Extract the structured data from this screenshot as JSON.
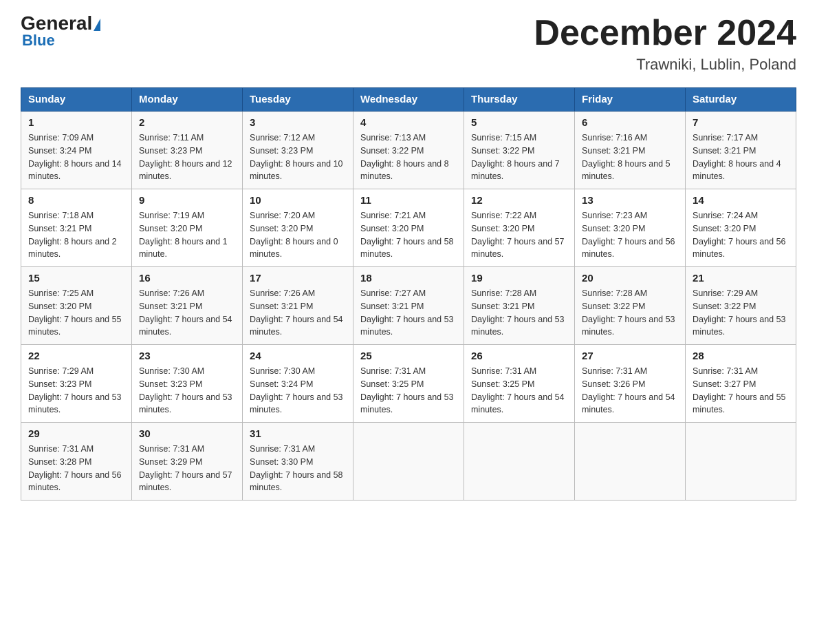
{
  "header": {
    "logo_general": "General",
    "logo_blue": "Blue",
    "month_title": "December 2024",
    "location": "Trawniki, Lublin, Poland"
  },
  "weekdays": [
    "Sunday",
    "Monday",
    "Tuesday",
    "Wednesday",
    "Thursday",
    "Friday",
    "Saturday"
  ],
  "weeks": [
    [
      {
        "day": "1",
        "sunrise": "7:09 AM",
        "sunset": "3:24 PM",
        "daylight": "8 hours and 14 minutes."
      },
      {
        "day": "2",
        "sunrise": "7:11 AM",
        "sunset": "3:23 PM",
        "daylight": "8 hours and 12 minutes."
      },
      {
        "day": "3",
        "sunrise": "7:12 AM",
        "sunset": "3:23 PM",
        "daylight": "8 hours and 10 minutes."
      },
      {
        "day": "4",
        "sunrise": "7:13 AM",
        "sunset": "3:22 PM",
        "daylight": "8 hours and 8 minutes."
      },
      {
        "day": "5",
        "sunrise": "7:15 AM",
        "sunset": "3:22 PM",
        "daylight": "8 hours and 7 minutes."
      },
      {
        "day": "6",
        "sunrise": "7:16 AM",
        "sunset": "3:21 PM",
        "daylight": "8 hours and 5 minutes."
      },
      {
        "day": "7",
        "sunrise": "7:17 AM",
        "sunset": "3:21 PM",
        "daylight": "8 hours and 4 minutes."
      }
    ],
    [
      {
        "day": "8",
        "sunrise": "7:18 AM",
        "sunset": "3:21 PM",
        "daylight": "8 hours and 2 minutes."
      },
      {
        "day": "9",
        "sunrise": "7:19 AM",
        "sunset": "3:20 PM",
        "daylight": "8 hours and 1 minute."
      },
      {
        "day": "10",
        "sunrise": "7:20 AM",
        "sunset": "3:20 PM",
        "daylight": "8 hours and 0 minutes."
      },
      {
        "day": "11",
        "sunrise": "7:21 AM",
        "sunset": "3:20 PM",
        "daylight": "7 hours and 58 minutes."
      },
      {
        "day": "12",
        "sunrise": "7:22 AM",
        "sunset": "3:20 PM",
        "daylight": "7 hours and 57 minutes."
      },
      {
        "day": "13",
        "sunrise": "7:23 AM",
        "sunset": "3:20 PM",
        "daylight": "7 hours and 56 minutes."
      },
      {
        "day": "14",
        "sunrise": "7:24 AM",
        "sunset": "3:20 PM",
        "daylight": "7 hours and 56 minutes."
      }
    ],
    [
      {
        "day": "15",
        "sunrise": "7:25 AM",
        "sunset": "3:20 PM",
        "daylight": "7 hours and 55 minutes."
      },
      {
        "day": "16",
        "sunrise": "7:26 AM",
        "sunset": "3:21 PM",
        "daylight": "7 hours and 54 minutes."
      },
      {
        "day": "17",
        "sunrise": "7:26 AM",
        "sunset": "3:21 PM",
        "daylight": "7 hours and 54 minutes."
      },
      {
        "day": "18",
        "sunrise": "7:27 AM",
        "sunset": "3:21 PM",
        "daylight": "7 hours and 53 minutes."
      },
      {
        "day": "19",
        "sunrise": "7:28 AM",
        "sunset": "3:21 PM",
        "daylight": "7 hours and 53 minutes."
      },
      {
        "day": "20",
        "sunrise": "7:28 AM",
        "sunset": "3:22 PM",
        "daylight": "7 hours and 53 minutes."
      },
      {
        "day": "21",
        "sunrise": "7:29 AM",
        "sunset": "3:22 PM",
        "daylight": "7 hours and 53 minutes."
      }
    ],
    [
      {
        "day": "22",
        "sunrise": "7:29 AM",
        "sunset": "3:23 PM",
        "daylight": "7 hours and 53 minutes."
      },
      {
        "day": "23",
        "sunrise": "7:30 AM",
        "sunset": "3:23 PM",
        "daylight": "7 hours and 53 minutes."
      },
      {
        "day": "24",
        "sunrise": "7:30 AM",
        "sunset": "3:24 PM",
        "daylight": "7 hours and 53 minutes."
      },
      {
        "day": "25",
        "sunrise": "7:31 AM",
        "sunset": "3:25 PM",
        "daylight": "7 hours and 53 minutes."
      },
      {
        "day": "26",
        "sunrise": "7:31 AM",
        "sunset": "3:25 PM",
        "daylight": "7 hours and 54 minutes."
      },
      {
        "day": "27",
        "sunrise": "7:31 AM",
        "sunset": "3:26 PM",
        "daylight": "7 hours and 54 minutes."
      },
      {
        "day": "28",
        "sunrise": "7:31 AM",
        "sunset": "3:27 PM",
        "daylight": "7 hours and 55 minutes."
      }
    ],
    [
      {
        "day": "29",
        "sunrise": "7:31 AM",
        "sunset": "3:28 PM",
        "daylight": "7 hours and 56 minutes."
      },
      {
        "day": "30",
        "sunrise": "7:31 AM",
        "sunset": "3:29 PM",
        "daylight": "7 hours and 57 minutes."
      },
      {
        "day": "31",
        "sunrise": "7:31 AM",
        "sunset": "3:30 PM",
        "daylight": "7 hours and 58 minutes."
      },
      null,
      null,
      null,
      null
    ]
  ]
}
